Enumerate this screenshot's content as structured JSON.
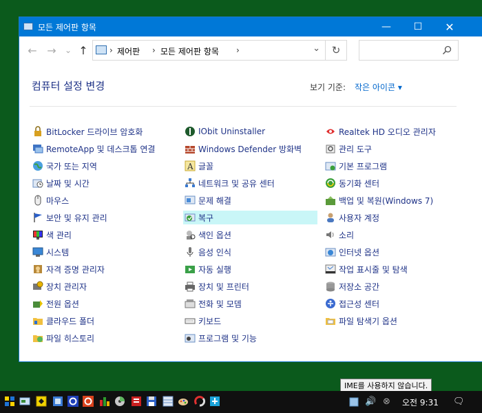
{
  "window": {
    "title": "모든 제어판 항목",
    "min_label": "—",
    "max_label": "☐",
    "close_label": "✕"
  },
  "nav": {
    "back": "←",
    "forward": "→",
    "recent": "⌄",
    "up": "↑"
  },
  "address": {
    "sep": "›",
    "crumbs": [
      "제어판",
      "모든 제어판 항목"
    ],
    "dropdown": "⌄",
    "refresh": "↻"
  },
  "search": {
    "value": "",
    "placeholder": ""
  },
  "header": {
    "title": "컴퓨터 설정 변경",
    "view_by_label": "보기 기준:",
    "view_by_value": "작은 아이콘 ▾"
  },
  "items": {
    "col1": [
      {
        "label": "BitLocker 드라이브 암호화",
        "icon": "bitlocker-icon"
      },
      {
        "label": "RemoteApp 및 데스크톱 연결",
        "icon": "remoteapp-icon"
      },
      {
        "label": "국가 또는 지역",
        "icon": "region-icon"
      },
      {
        "label": "날짜 및 시간",
        "icon": "datetime-icon"
      },
      {
        "label": "마우스",
        "icon": "mouse-icon"
      },
      {
        "label": "보안 및 유지 관리",
        "icon": "flag-icon"
      },
      {
        "label": "색 관리",
        "icon": "color-management-icon"
      },
      {
        "label": "시스템",
        "icon": "system-icon"
      },
      {
        "label": "자격 증명 관리자",
        "icon": "credential-icon"
      },
      {
        "label": "장치 관리자",
        "icon": "device-manager-icon"
      },
      {
        "label": "전원 옵션",
        "icon": "power-icon"
      },
      {
        "label": "클라우드 폴더",
        "icon": "cloud-folder-icon"
      },
      {
        "label": "파일 히스토리",
        "icon": "file-history-icon"
      }
    ],
    "col2": [
      {
        "label": "IObit Uninstaller",
        "icon": "iobit-icon"
      },
      {
        "label": "Windows Defender 방화벽",
        "icon": "firewall-icon"
      },
      {
        "label": "글꼴",
        "icon": "font-icon"
      },
      {
        "label": "네트워크 및 공유 센터",
        "icon": "network-icon"
      },
      {
        "label": "문제 해결",
        "icon": "troubleshoot-icon"
      },
      {
        "label": "복구",
        "icon": "recovery-icon"
      },
      {
        "label": "색인 옵션",
        "icon": "indexing-icon"
      },
      {
        "label": "음성 인식",
        "icon": "microphone-icon"
      },
      {
        "label": "자동 실행",
        "icon": "autoplay-icon"
      },
      {
        "label": "장치 및 프린터",
        "icon": "printer-icon"
      },
      {
        "label": "전화 및 모뎀",
        "icon": "phone-icon"
      },
      {
        "label": "키보드",
        "icon": "keyboard-icon"
      },
      {
        "label": "프로그램 및 기능",
        "icon": "programs-icon"
      }
    ],
    "col3": [
      {
        "label": "Realtek HD 오디오 관리자",
        "icon": "realtek-icon"
      },
      {
        "label": "관리 도구",
        "icon": "admin-tools-icon"
      },
      {
        "label": "기본 프로그램",
        "icon": "default-programs-icon"
      },
      {
        "label": "동기화 센터",
        "icon": "sync-icon"
      },
      {
        "label": "백업 및 복원(Windows 7)",
        "icon": "backup-icon"
      },
      {
        "label": "사용자 계정",
        "icon": "user-accounts-icon"
      },
      {
        "label": "소리",
        "icon": "sound-icon"
      },
      {
        "label": "인터넷 옵션",
        "icon": "internet-options-icon"
      },
      {
        "label": "작업 표시줄 및 탐색",
        "icon": "taskbar-icon"
      },
      {
        "label": "저장소 공간",
        "icon": "storage-icon"
      },
      {
        "label": "접근성 센터",
        "icon": "accessibility-icon"
      },
      {
        "label": "파일 탐색기 옵션",
        "icon": "folder-options-icon"
      }
    ],
    "selected": "복구"
  },
  "taskbar": {
    "tooltip": "IME를 사용하지 않습니다.",
    "clock": "오전 9:31",
    "volume": "🔊",
    "ime": "⊗",
    "notification": "🗨"
  },
  "colors": {
    "accent": "#0078d7",
    "link": "#1e3287",
    "selection": "#c9f6f7",
    "desktop": "#0b5a1c"
  }
}
